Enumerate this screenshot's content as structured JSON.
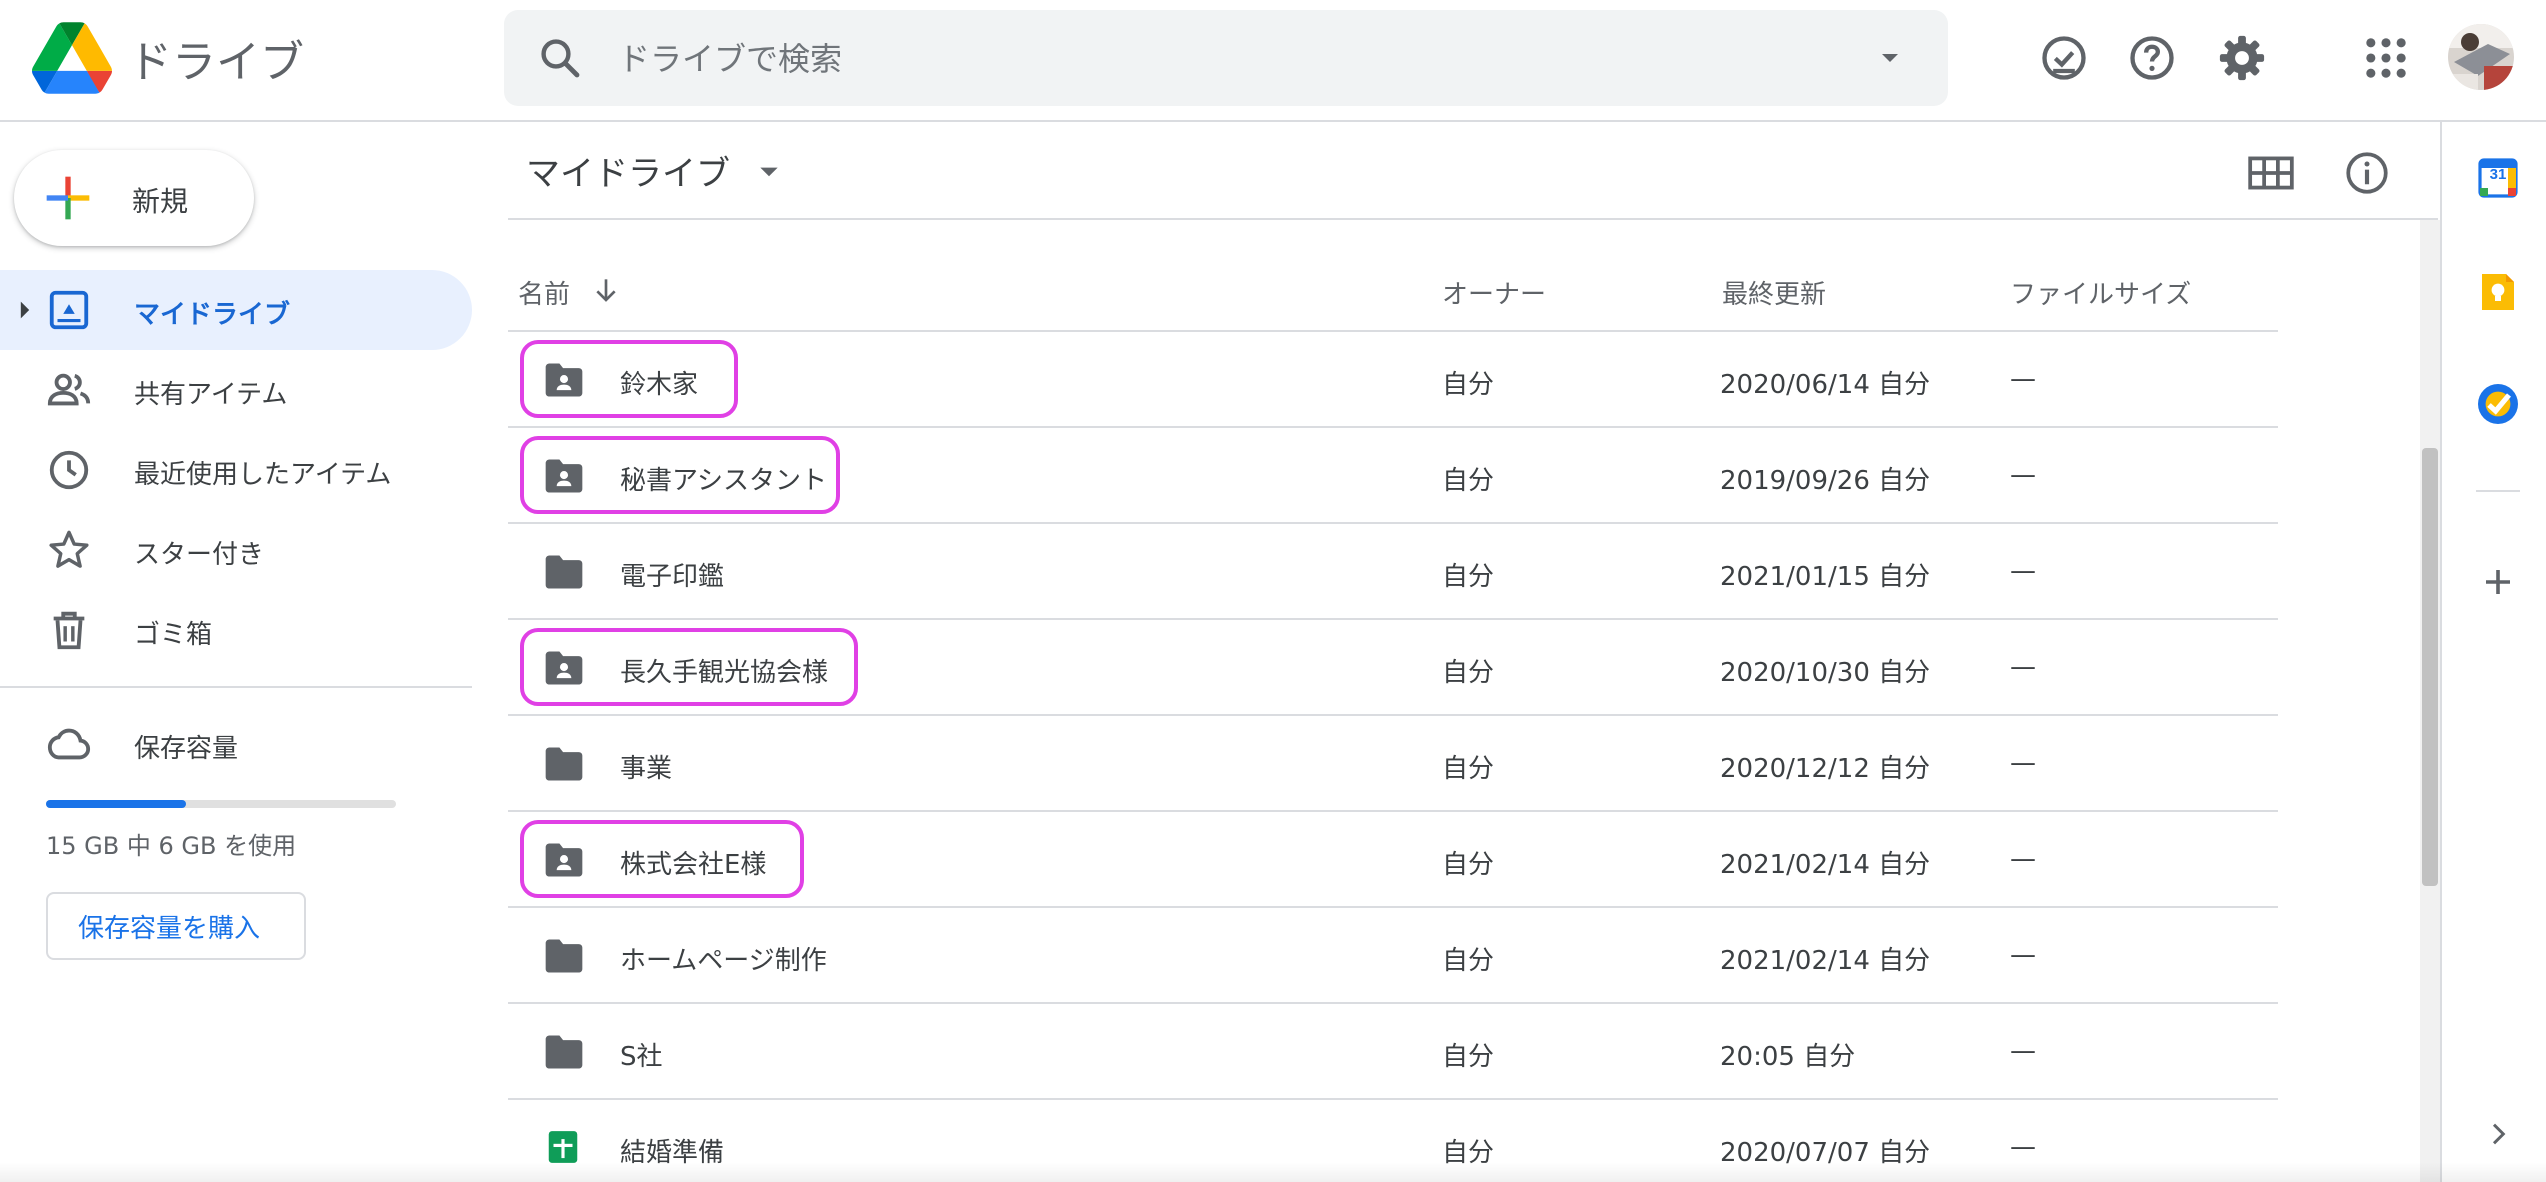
{
  "app": {
    "title": "ドライブ"
  },
  "search": {
    "placeholder": "ドライブで検索"
  },
  "header_icons": [
    "offline-ready-icon",
    "help-icon",
    "settings-icon",
    "apps-grid-icon",
    "account-avatar"
  ],
  "sidebar": {
    "new_label": "新規",
    "items": [
      {
        "label": "マイドライブ",
        "icon": "my-drive-icon",
        "active": true
      },
      {
        "label": "共有アイテム",
        "icon": "shared-people-icon",
        "active": false
      },
      {
        "label": "最近使用したアイテム",
        "icon": "clock-icon",
        "active": false
      },
      {
        "label": "スター付き",
        "icon": "star-icon",
        "active": false
      },
      {
        "label": "ゴミ箱",
        "icon": "trash-icon",
        "active": false
      }
    ],
    "storage": {
      "label": "保存容量",
      "usage_text": "15 GB 中 6 GB を使用",
      "used_fraction": 0.4,
      "buy_label": "保存容量を購入"
    }
  },
  "main": {
    "title": "マイドライブ",
    "columns": {
      "name": "名前",
      "owner": "オーナー",
      "modified": "最終更新",
      "size": "ファイルサイズ"
    },
    "rows": [
      {
        "name": "鈴木家",
        "type": "shared-folder",
        "owner": "自分",
        "modified": "2020/06/14 自分",
        "size": "—",
        "highlighted": true
      },
      {
        "name": "秘書アシスタント",
        "type": "shared-folder",
        "owner": "自分",
        "modified": "2019/09/26 自分",
        "size": "—",
        "highlighted": true
      },
      {
        "name": "電子印鑑",
        "type": "folder",
        "owner": "自分",
        "modified": "2021/01/15 自分",
        "size": "—",
        "highlighted": false
      },
      {
        "name": "長久手観光協会様",
        "type": "shared-folder",
        "owner": "自分",
        "modified": "2020/10/30 自分",
        "size": "—",
        "highlighted": true
      },
      {
        "name": "事業",
        "type": "folder",
        "owner": "自分",
        "modified": "2020/12/12 自分",
        "size": "—",
        "highlighted": false
      },
      {
        "name": "株式会社E様",
        "type": "shared-folder",
        "owner": "自分",
        "modified": "2021/02/14 自分",
        "size": "—",
        "highlighted": true
      },
      {
        "name": "ホームページ制作",
        "type": "folder",
        "owner": "自分",
        "modified": "2021/02/14 自分",
        "size": "—",
        "highlighted": false
      },
      {
        "name": "S社",
        "type": "folder",
        "owner": "自分",
        "modified": "20:05 自分",
        "size": "—",
        "highlighted": false
      },
      {
        "name": "結婚準備",
        "type": "spreadsheet",
        "owner": "自分",
        "modified": "2020/07/07 自分",
        "size": "—",
        "highlighted": false
      }
    ]
  },
  "side_panel": {
    "calendar_day": "31",
    "icons": [
      "calendar-icon",
      "keep-icon",
      "tasks-icon",
      "add-addon-icon",
      "expand-panel-icon"
    ]
  },
  "colors": {
    "accent": "#1a73e8",
    "active_bg": "#e8f0fe",
    "highlight": "#e040e5",
    "folder": "#5f6368",
    "sheets": "#0f9d58"
  }
}
